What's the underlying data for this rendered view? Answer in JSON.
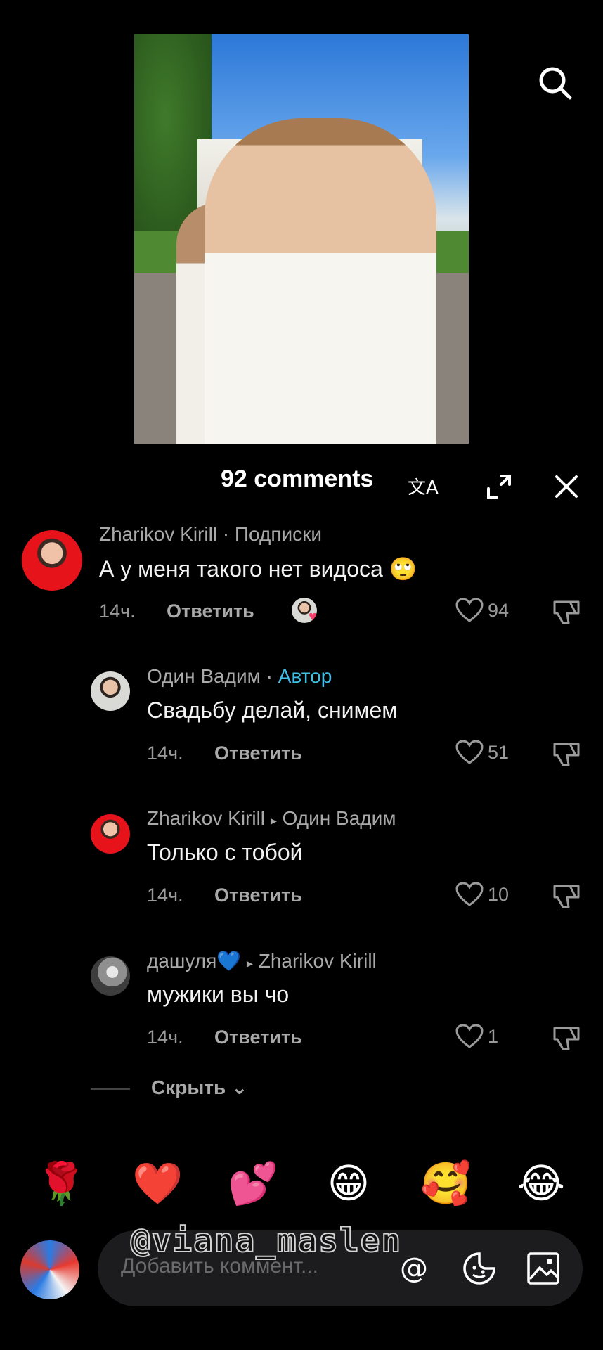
{
  "header": {
    "comments_count": "92 comments"
  },
  "comments": [
    {
      "name": "Zharikov Kirill",
      "sep": " · ",
      "tag": "Подписки",
      "text": "А у меня такого нет видоса 🙄",
      "time": "14ч.",
      "reply": "Ответить",
      "likes": "94"
    },
    {
      "name": "Один Вадим",
      "sep": " · ",
      "tag": "Автор",
      "text": "Свадьбу делай, снимем",
      "time": "14ч.",
      "reply": "Ответить",
      "likes": "51"
    },
    {
      "name": "Zharikov Kirill",
      "arrow": "▸",
      "reply_to": "Один Вадим",
      "text": "Только с тобой",
      "time": "14ч.",
      "reply": "Ответить",
      "likes": "10"
    },
    {
      "name": "дашуля💙",
      "arrow": "▸",
      "reply_to": "Zharikov Kirill",
      "text": "мужики вы чо",
      "time": "14ч.",
      "reply": "Ответить",
      "likes": "1"
    }
  ],
  "hide_replies": "Скрыть ⌄",
  "quick_emojis": [
    "🌹",
    "❤️",
    "💕",
    "😁",
    "🥰",
    "😂"
  ],
  "composer": {
    "placeholder": "Добавить коммент..."
  },
  "watermark": "@viana_maslen",
  "colors": {
    "background": "#000000",
    "author_tag": "#3ec0e8",
    "composer_bg": "#1c1c1e"
  }
}
